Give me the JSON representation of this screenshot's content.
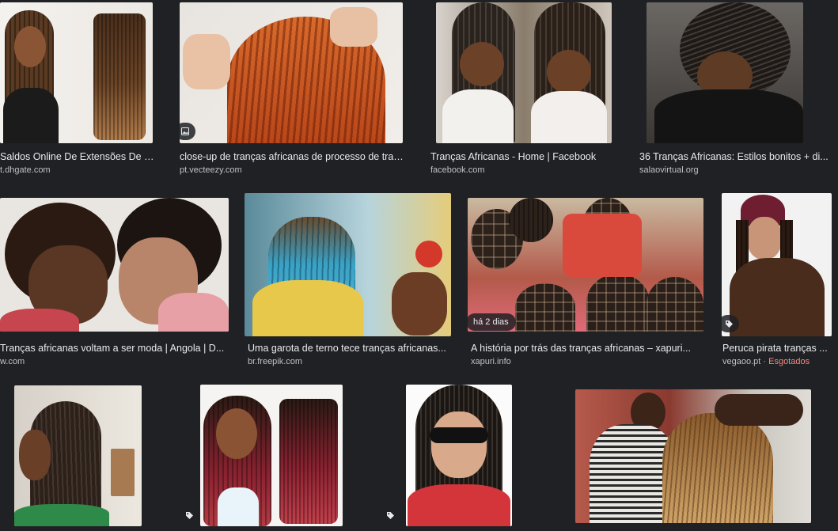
{
  "results": [
    {
      "title": "Saldos Online De Extensões De Ca...",
      "source": "t.dhgate.com"
    },
    {
      "title": "close-up de tranças africanas de processo de tran...",
      "source": "pt.vecteezy.com",
      "badge_icon": "image-icon"
    },
    {
      "title": "Tranças Africanas - Home | Facebook",
      "source": "facebook.com"
    },
    {
      "title": "36 Tranças Africanas: Estilos bonitos + di...",
      "source": "salaovirtual.org"
    },
    {
      "title": "Tranças africanas voltam a ser moda | Angola | D...",
      "source": "w.com"
    },
    {
      "title": "Uma garota de terno tece tranças africanas...",
      "source": "br.freepik.com"
    },
    {
      "title": "A história por trás das tranças africanas – xapuri...",
      "source": "xapuri.info",
      "badge_text": "há 2 dias"
    },
    {
      "title": "Peruca pirata tranças ...",
      "source": "vegaoo.pt",
      "status": "· Esgotados",
      "badge_icon": "tag-icon"
    },
    {
      "badge_icon": "tag-icon"
    },
    {
      "badge_icon": "tag-icon"
    },
    {},
    {}
  ],
  "colors": {
    "background": "#202124",
    "title_text": "#e8eaed",
    "source_text": "#bdc1c6",
    "status_soldout": "#f28b82"
  }
}
